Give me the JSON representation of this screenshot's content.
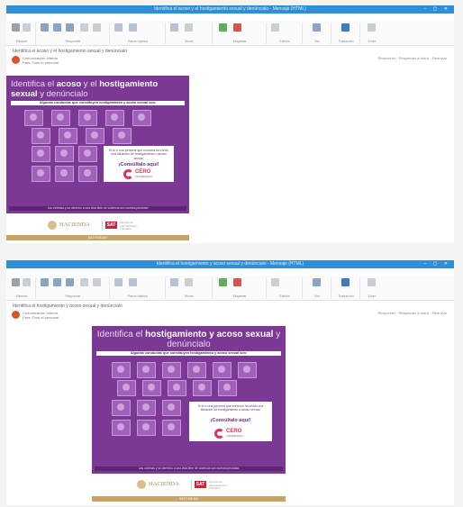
{
  "shots": [
    {
      "window_title": "Identifica el acoso y el hostigamiento sexual y denúncialo - Mensaje (HTML)",
      "tabs": [
        "Archivo",
        "Mensaje",
        "Ayuda",
        "Qué desea hacer"
      ],
      "active_tab": 1,
      "ribbon_groups": [
        "Eliminar",
        "Responder",
        "Pasos rápidos",
        "Mover",
        "Etiquetas",
        "Edición",
        "Voz",
        "Traducción",
        "Zoom"
      ],
      "subject": "Identifica el acoso y el hostigamiento sexual y denúncialo",
      "sender": "Comunicación Interna",
      "recipient_line": "Para: Todo el personal",
      "header_actions": "Responder · Responder a todos · Reenviar",
      "poster": {
        "title_a": "Identifica el ",
        "title_b": "acoso",
        "title_c": " y el ",
        "title_d": "hostigamiento sexual",
        "title_e": " y denúncialo",
        "subtitle": "Algunas conductas que constituyen hostigamiento y acoso sexual son:",
        "callout_text": "Si tú o una persona que conoces ha vivido una situación de hostigamiento o acoso sexual:",
        "cta": "¡Consúltalo aquí!",
        "cero_main": "CERO",
        "cero_sub": "TOLERANCIA",
        "footer": "Las víctimas y su derecho a una vida libre de violencia son nuestra prioridad"
      },
      "logos": {
        "hacienda": "HACIENDA",
        "sat": "SAT",
        "sat_sub": "Servicio de Administración Tributaria"
      },
      "goldbar": "SAT.GOB.MX"
    },
    {
      "window_title": "Identifica el hostigamiento y acoso sexual y denúncialo - Mensaje (HTML)",
      "tabs": [
        "Archivo",
        "Mensaje",
        "Ayuda",
        "Qué desea hacer"
      ],
      "active_tab": 1,
      "ribbon_groups": [
        "Eliminar",
        "Responder",
        "Pasos rápidos",
        "Mover",
        "Etiquetas",
        "Edición",
        "Voz",
        "Traducción",
        "Zoom"
      ],
      "subject": "Identifica el hostigamiento y acoso sexual y denúncialo",
      "sender": "Comunicación Interna",
      "recipient_line": "Para: Todo el personal",
      "header_actions": "Responder · Responder a todos · Reenviar",
      "poster": {
        "title_a": "Identifica el ",
        "title_b": "hostigamiento y acoso",
        "title_c": " ",
        "title_d": "sexual",
        "title_e": " y denúncialo",
        "subtitle": "Algunas conductas que constituyen hostigamiento y acoso sexual son:",
        "callout_text": "Si tú o una persona que conoces ha vivido una situación de hostigamiento o acoso sexual:",
        "cta": "¡Consúltalo aquí!",
        "cero_main": "CERO",
        "cero_sub": "TOLERANCIA",
        "footer": "Las víctimas y su derecho a una vida libre de violencia son nuestra prioridad"
      },
      "logos": {
        "hacienda": "HACIENDA",
        "sat": "SAT",
        "sat_sub": "Servicio de Administración Tributaria"
      },
      "goldbar": "SAT.GOB.MX"
    }
  ],
  "colors": {
    "titlebar": "#2f8fd6",
    "poster": "#7b3894",
    "tile": "#a160b9",
    "cero": "#e0325f",
    "gold": "#c9a365",
    "avatar": "#d9542b"
  }
}
